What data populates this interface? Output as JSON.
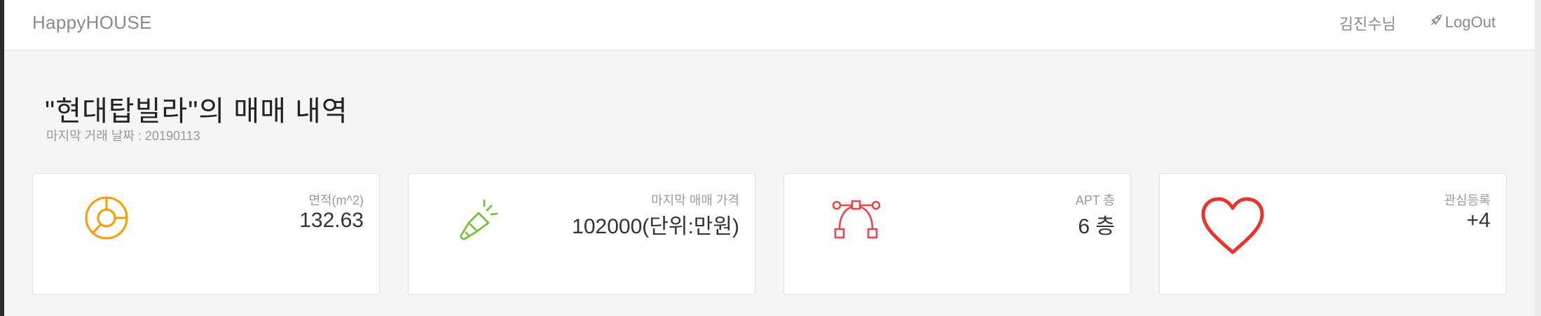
{
  "navbar": {
    "brand": "HappyHOUSE",
    "user": "김진수님",
    "logout": "LogOut"
  },
  "header": {
    "title": "\"현대탑빌라\"의 매매 내역",
    "subtitle": "마지막 거래 날짜 : 20190113"
  },
  "cards": [
    {
      "icon": "pie-chart-icon",
      "label": "면적(m^2)",
      "value": "132.63",
      "color": "#ff9900"
    },
    {
      "icon": "flashlight-icon",
      "label": "마지막 매매 가격",
      "value": "102000(단위:만원)",
      "color": "#7ac142"
    },
    {
      "icon": "bezier-curve-icon",
      "label": "APT 층",
      "value": "6 층",
      "color": "#e8454f"
    },
    {
      "icon": "heart-icon",
      "label": "관심등록",
      "value": "+4",
      "color": "#e8352b"
    }
  ]
}
